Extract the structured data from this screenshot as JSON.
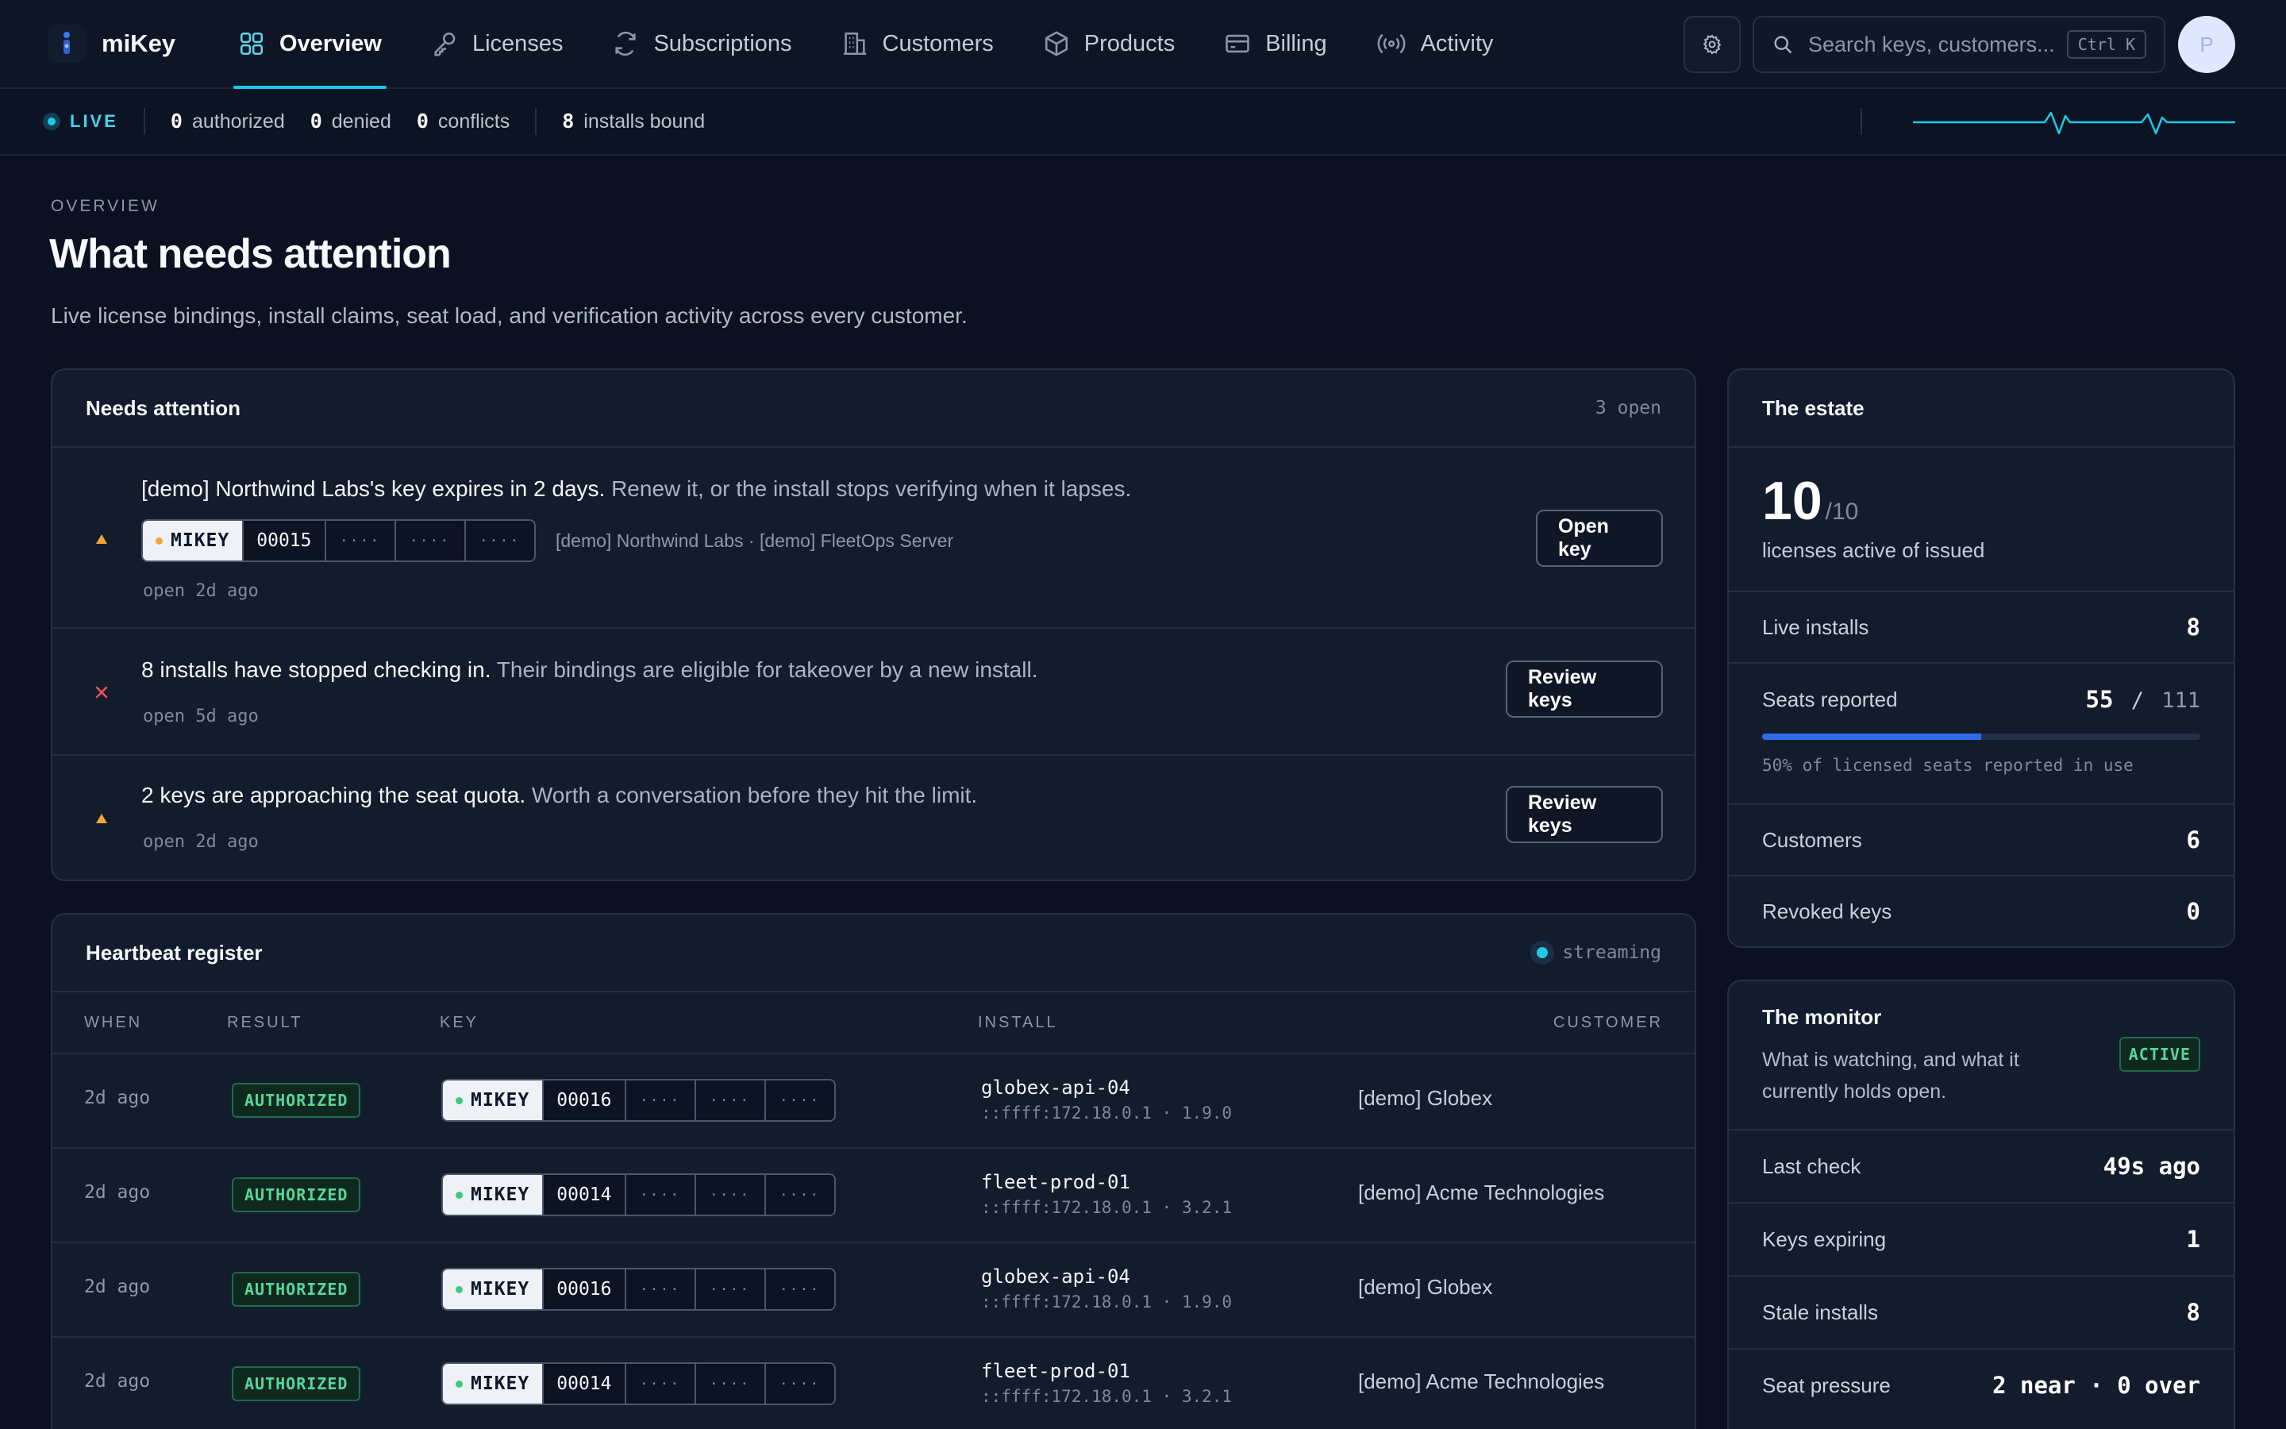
{
  "brand": {
    "name": "miKey",
    "logo_icon": "key-logo-icon"
  },
  "nav": {
    "tabs": [
      {
        "label": "Overview",
        "icon": "grid-icon",
        "active": true
      },
      {
        "label": "Licenses",
        "icon": "key-icon"
      },
      {
        "label": "Subscriptions",
        "icon": "refresh-icon"
      },
      {
        "label": "Customers",
        "icon": "building-icon"
      },
      {
        "label": "Products",
        "icon": "box-icon"
      },
      {
        "label": "Billing",
        "icon": "card-icon"
      },
      {
        "label": "Activity",
        "icon": "broadcast-icon"
      }
    ],
    "settings_icon": "gear-icon",
    "search_placeholder": "Search keys, customers...",
    "search_shortcut": "Ctrl K",
    "avatar_initial": "P"
  },
  "status": {
    "live_label": "LIVE",
    "authorized_count": "0",
    "authorized_label": "authorized",
    "denied_count": "0",
    "denied_label": "denied",
    "conflicts_count": "0",
    "conflicts_label": "conflicts",
    "installs_count": "8",
    "installs_label": "installs bound"
  },
  "header": {
    "eyebrow": "OVERVIEW",
    "title": "What needs attention",
    "subtitle": "Live license bindings, install claims, seat load, and verification activity across every customer."
  },
  "attention": {
    "title": "Needs attention",
    "meta": "3 open",
    "items": [
      {
        "headline": "[demo] Northwind Labs's key expires in 2 days.",
        "detail": " Renew it, or the install stops verifying when it lapses.",
        "key_brand": "MIKEY",
        "key_number": "00015",
        "key_mask": "····",
        "context": "[demo] Northwind Labs · [demo] FleetOps Server",
        "ago": "open 2d ago",
        "action": "Open key",
        "severity": "warning"
      },
      {
        "headline": "8 installs have stopped checking in.",
        "detail": " Their bindings are eligible for takeover by a new install.",
        "ago": "open 5d ago",
        "action": "Review keys",
        "severity": "error"
      },
      {
        "headline": "2 keys are approaching the seat quota.",
        "detail": " Worth a conversation before they hit the limit.",
        "ago": "open 2d ago",
        "action": "Review keys",
        "severity": "warning"
      }
    ]
  },
  "heartbeat": {
    "title": "Heartbeat register",
    "meta": "streaming",
    "columns": {
      "when": "WHEN",
      "result": "RESULT",
      "key": "KEY",
      "install": "INSTALL",
      "customer": "CUSTOMER"
    },
    "rows": [
      {
        "when": "2d ago",
        "result": "AUTHORIZED",
        "key_brand": "MIKEY",
        "key_number": "00016",
        "key_mask": "····",
        "host": "globex-api-04",
        "addr": "::ffff:172.18.0.1 · 1.9.0",
        "customer": "[demo] Globex"
      },
      {
        "when": "2d ago",
        "result": "AUTHORIZED",
        "key_brand": "MIKEY",
        "key_number": "00014",
        "key_mask": "····",
        "host": "fleet-prod-01",
        "addr": "::ffff:172.18.0.1 · 3.2.1",
        "customer": "[demo] Acme Technologies"
      },
      {
        "when": "2d ago",
        "result": "AUTHORIZED",
        "key_brand": "MIKEY",
        "key_number": "00016",
        "key_mask": "····",
        "host": "globex-api-04",
        "addr": "::ffff:172.18.0.1 · 1.9.0",
        "customer": "[demo] Globex"
      },
      {
        "when": "2d ago",
        "result": "AUTHORIZED",
        "key_brand": "MIKEY",
        "key_number": "00014",
        "key_mask": "····",
        "host": "fleet-prod-01",
        "addr": "::ffff:172.18.0.1 · 3.2.1",
        "customer": "[demo] Acme Technologies"
      }
    ]
  },
  "estate": {
    "title": "The estate",
    "active": "10",
    "issued": "/10",
    "caption": "licenses active of issued",
    "live_installs_label": "Live installs",
    "live_installs": "8",
    "seats_label": "Seats reported",
    "seats_used": "55",
    "seats_sep": "/",
    "seats_total": "111",
    "seats_fraction": 0.5,
    "seats_caption": "50% of licensed seats reported in use",
    "customers_label": "Customers",
    "customers": "6",
    "revoked_label": "Revoked keys",
    "revoked": "0"
  },
  "monitor": {
    "title": "The monitor",
    "subtitle": "What is watching, and what it currently holds open.",
    "badge": "ACTIVE",
    "last_check_label": "Last check",
    "last_check": "49s ago",
    "expiring_label": "Keys expiring",
    "expiring": "1",
    "stale_label": "Stale installs",
    "stale": "8",
    "pressure_label": "Seat pressure",
    "pressure": "2 near · 0 over"
  },
  "colors": {
    "accent": "#1ec8e6",
    "ok": "#58d69a",
    "warn": "#f2a33a",
    "error": "#ef4f5f",
    "progress": "#2f6de8"
  }
}
